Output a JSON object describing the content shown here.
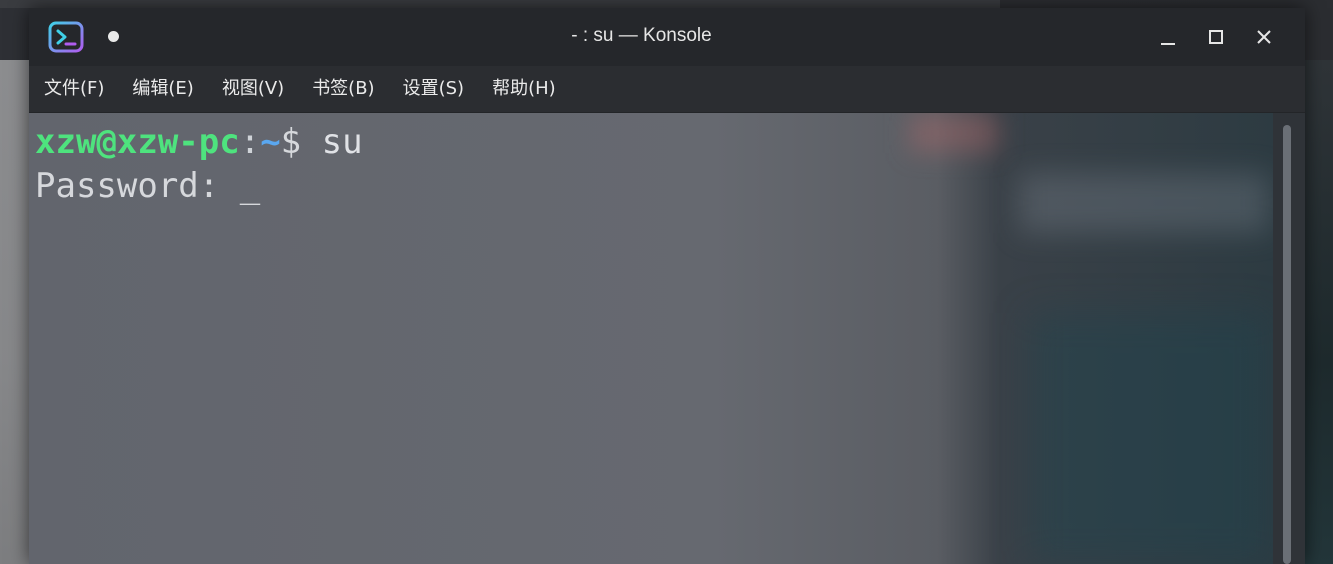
{
  "window": {
    "title": "- : su — Konsole",
    "app_icon": "konsole-icon",
    "controls": {
      "minimize": "minimize-icon",
      "maximize": "maximize-icon",
      "close": "close-icon"
    }
  },
  "menubar": {
    "items": [
      {
        "label": "文件(F)"
      },
      {
        "label": "编辑(E)"
      },
      {
        "label": "视图(V)"
      },
      {
        "label": "书签(B)"
      },
      {
        "label": "设置(S)"
      },
      {
        "label": "帮助(H)"
      }
    ]
  },
  "terminal": {
    "prompt_user_host": "xzw@xzw-pc",
    "prompt_colon": ":",
    "prompt_path": "~",
    "prompt_symbol": "$",
    "command": " su",
    "password_prompt": "Password: ",
    "cursor": "_"
  },
  "colors": {
    "user_host": "#4ee37e",
    "path": "#5aa7f0",
    "text": "#d6d8dc"
  }
}
